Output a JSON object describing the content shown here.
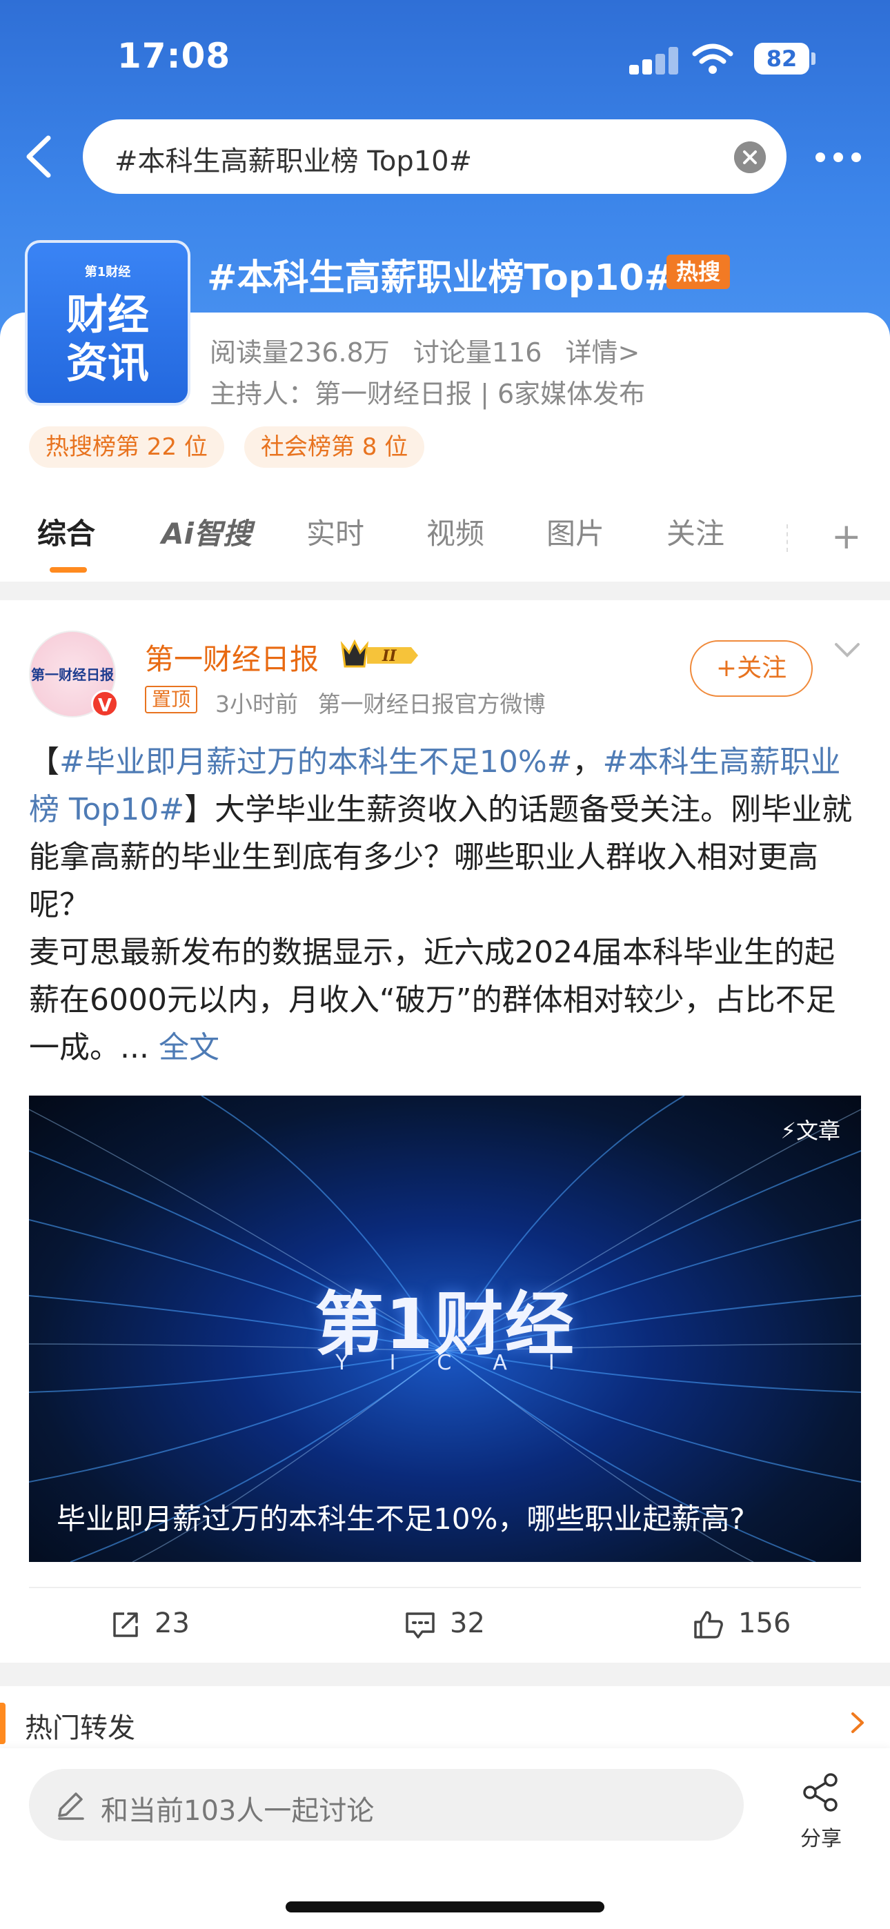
{
  "status_bar": {
    "time": "17:08",
    "battery": "82"
  },
  "search": {
    "query": "#本科生高薪职业榜 Top10#"
  },
  "topic": {
    "logo_small": "第1财经",
    "logo_line1": "财经",
    "logo_line2": "资讯",
    "title": "#本科生高薪职业榜Top10#",
    "hot_badge": "热搜",
    "reads": "阅读量236.8万",
    "discussions": "讨论量116",
    "details": "详情>",
    "host": "主持人：第一财经日报 | 6家媒体发布",
    "rank_hot": "热搜榜第 22 位",
    "rank_social": "社会榜第 8 位"
  },
  "tabs": [
    {
      "label": "综合"
    },
    {
      "label": "Ai智搜"
    },
    {
      "label": "实时"
    },
    {
      "label": "视频"
    },
    {
      "label": "图片"
    },
    {
      "label": "关注"
    }
  ],
  "post": {
    "avatar_text": "第一财经日报",
    "verify": "V",
    "author": "第一财经日报",
    "vip_level": "II",
    "pinned": "置顶",
    "time_ago": "3小时前",
    "source": "第一财经日报官方微博",
    "follow": "+关注",
    "text_open": "【",
    "hashtag1": "#毕业即月薪过万的本科生不足10%#",
    "comma": "，",
    "hashtag2": "#本科生高薪职业榜 Top10#",
    "text_close": "】",
    "body1": "大学毕业生薪资收入的话题备受关注。刚毕业就能拿高薪的毕业生到底有多少？哪些职业人群收入相对更高呢？",
    "body2": "麦可思最新发布的数据显示，近六成2024届本科毕业生的起薪在6000元以内，月收入“破万”的群体相对较少，占比不足一成。...",
    "read_more": "全文",
    "video": {
      "tag": "文章",
      "logo": "第1财经",
      "logo_sub": "YICAI",
      "caption": "毕业即月薪过万的本科生不足10%，哪些职业起薪高?"
    },
    "shares": "23",
    "comments": "32",
    "likes": "156"
  },
  "hot_forward": {
    "label": "热门转发"
  },
  "bottom": {
    "placeholder": "和当前103人一起讨论",
    "share": "分享"
  },
  "colors": {
    "accent": "#ff8a1f",
    "brand_blue": "#3c85ea",
    "link": "#4e7bb5"
  }
}
